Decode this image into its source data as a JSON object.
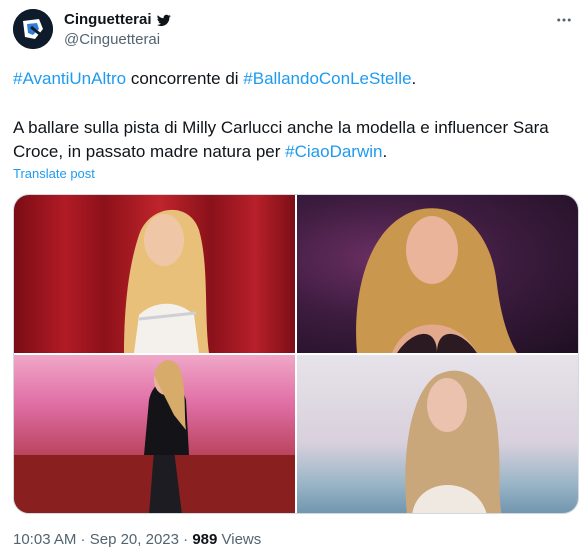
{
  "author": {
    "name": "Cinguetterai",
    "handle": "@Cinguetterai"
  },
  "icons": {
    "avatar": "avatar-logo",
    "verified": "bird-icon",
    "more": "more-icon"
  },
  "tweet": {
    "line1": {
      "tag1": "#AvantiUnAltro",
      "text1": " concorrente di ",
      "tag2": "#BallandoConLeStelle",
      "text2": "."
    },
    "line2": "A ballare sulla pista di Milly Carlucci anche la modella e influencer Sara",
    "line3": {
      "text": "Croce, in passato madre natura per ",
      "tag": "#CiaoDarwin",
      "end": "."
    },
    "translate": "Translate post"
  },
  "footer": {
    "time": "10:03 AM",
    "sep": " · ",
    "date": "Sep 20, 2023",
    "views_count": "989",
    "views_label": " Views"
  },
  "colors": {
    "link": "#1d9bf0",
    "muted": "#536471",
    "text": "#0f1419"
  }
}
